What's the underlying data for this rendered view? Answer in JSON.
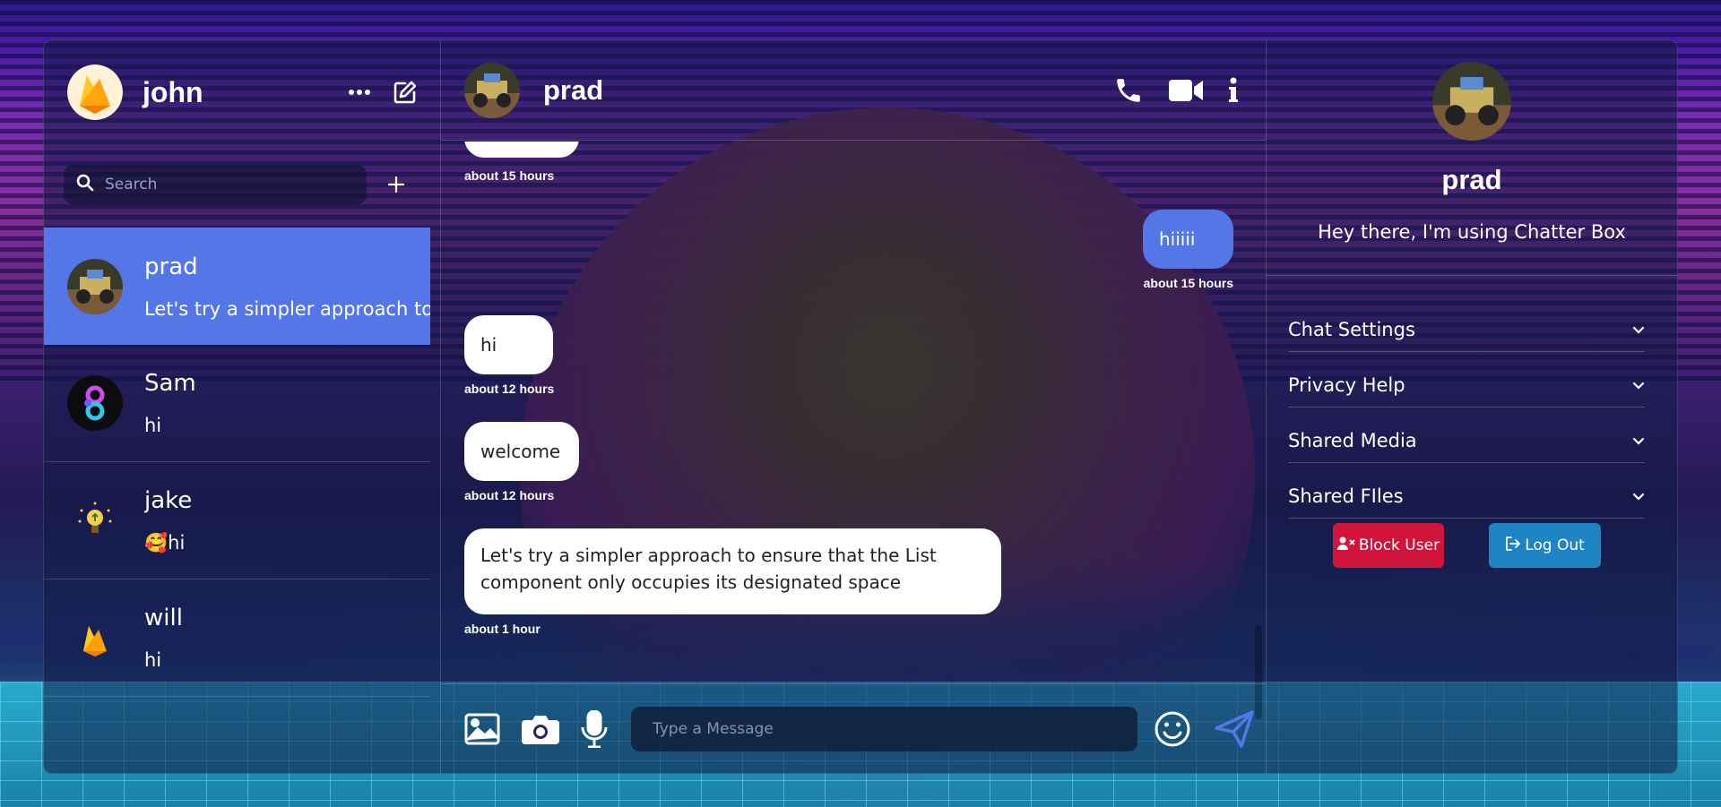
{
  "current_user": {
    "name": "john",
    "avatar_icon": "flame-logo-icon"
  },
  "search": {
    "placeholder": "Search"
  },
  "chats": [
    {
      "name": "prad",
      "preview": "Let's try a simpler approach to ensure that the List component only occupies its designated space",
      "active": true
    },
    {
      "name": "Sam",
      "preview": "hi",
      "active": false
    },
    {
      "name": "jake",
      "preview": "🥰hi",
      "active": false
    },
    {
      "name": "will",
      "preview": "hi",
      "active": false
    }
  ],
  "conversation": {
    "name": "prad",
    "messages": [
      {
        "text": "",
        "time": "about 15 hours",
        "own": false
      },
      {
        "text": "hiiiii",
        "time": "about 15 hours",
        "own": true
      },
      {
        "text": "hi",
        "time": "about 12 hours",
        "own": false
      },
      {
        "text": "welcome",
        "time": "about 12 hours",
        "own": false
      },
      {
        "text": "Let's try a simpler approach to ensure that the List component only occupies its designated space",
        "time": "about 1 hour",
        "own": false
      }
    ]
  },
  "composer": {
    "placeholder": "Type a Message"
  },
  "profile": {
    "name": "prad",
    "status": "Hey there, I'm using Chatter Box"
  },
  "details_sections": [
    "Chat Settings",
    "Privacy Help",
    "Shared Media",
    "Shared FIles"
  ],
  "actions": {
    "block_label": "Block User",
    "logout_label": "Log Out"
  },
  "colors": {
    "accent": "#5476e6",
    "block": "#d0143a",
    "logout": "#1f84c4"
  }
}
